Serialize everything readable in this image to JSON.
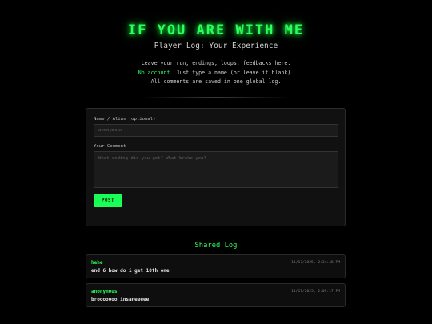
{
  "header": {
    "title": "IF YOU ARE WITH ME",
    "subtitle": "Player Log: Your Experience",
    "intro_line1": "Leave your run, endings, loops, feedbacks here.",
    "intro_highlight": "No account.",
    "intro_line2_rest": " Just type a name (or leave it blank).",
    "intro_line3": "All comments are saved in one global log."
  },
  "form": {
    "name_label": "Name / Alias (optional)",
    "name_placeholder": "anonymous",
    "name_value": "",
    "comment_label": "Your Comment",
    "comment_placeholder": "What ending did you get? What broke you?",
    "comment_value": "",
    "post_label": "POST"
  },
  "log": {
    "title": "Shared Log",
    "entries": [
      {
        "author": "hehe",
        "time": "11/17/2025, 2:34:48 PM",
        "comment": "end 6 how do i get 10th one"
      },
      {
        "author": "anonymous",
        "time": "11/17/2025, 2:09:17 PM",
        "comment": "brooooooo insaneeeee"
      }
    ]
  },
  "colors": {
    "accent": "#2bff5a",
    "background": "#000000",
    "card": "#111111",
    "button": "#1aff55"
  }
}
